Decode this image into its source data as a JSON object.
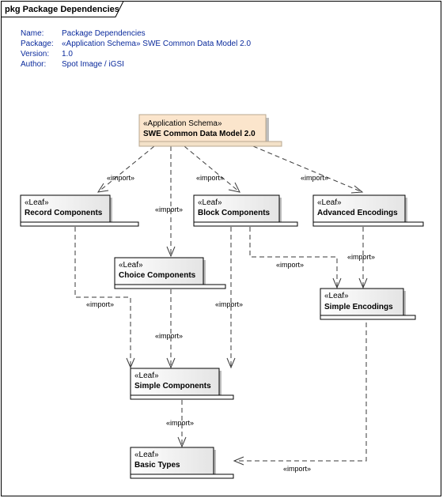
{
  "frame": {
    "title": "pkg Package Dependencies"
  },
  "meta": [
    {
      "key": "Name:",
      "value": "Package Dependencies"
    },
    {
      "key": "Package:",
      "value": "«Application Schema» SWE Common Data Model 2.0"
    },
    {
      "key": "Version:",
      "value": "1.0"
    },
    {
      "key": "Author:",
      "value": "Spot Image / iGSI"
    }
  ],
  "colors": {
    "root_fill": "#fbe5cc",
    "leaf_fill_light": "#ffffff",
    "leaf_fill_dark": "#e6e6e6",
    "meta_text": "#0a2a9c",
    "line": "#3a3a3a"
  },
  "packages": {
    "root": {
      "stereotype": "«Application Schema»",
      "name": "SWE Common Data Model 2.0"
    },
    "record": {
      "stereotype": "«Leaf»",
      "name": "Record Components"
    },
    "block": {
      "stereotype": "«Leaf»",
      "name": "Block Components"
    },
    "advanced": {
      "stereotype": "«Leaf»",
      "name": "Advanced Encodings"
    },
    "choice": {
      "stereotype": "«Leaf»",
      "name": "Choice Components"
    },
    "simple_enc": {
      "stereotype": "«Leaf»",
      "name": "Simple Encodings"
    },
    "simple_comp": {
      "stereotype": "«Leaf»",
      "name": "Simple Components"
    },
    "basic": {
      "stereotype": "«Leaf»",
      "name": "Basic Types"
    }
  },
  "dependency_label": "«import»",
  "dependencies": [
    {
      "from": "SWE Common Data Model 2.0",
      "to": "Record Components",
      "label": "«import»"
    },
    {
      "from": "SWE Common Data Model 2.0",
      "to": "Choice Components",
      "label": "«import»"
    },
    {
      "from": "SWE Common Data Model 2.0",
      "to": "Block Components",
      "label": "«import»"
    },
    {
      "from": "SWE Common Data Model 2.0",
      "to": "Advanced Encodings",
      "label": "«import»"
    },
    {
      "from": "Block Components",
      "to": "Simple Encodings",
      "label": "«import»"
    },
    {
      "from": "Advanced Encodings",
      "to": "Simple Encodings",
      "label": "«import»"
    },
    {
      "from": "Record Components",
      "to": "Simple Components",
      "label": "«import»"
    },
    {
      "from": "Choice Components",
      "to": "Simple Components",
      "label": "«import»"
    },
    {
      "from": "Block Components",
      "to": "Simple Components",
      "label": "«import»"
    },
    {
      "from": "Simple Components",
      "to": "Basic Types",
      "label": "«import»"
    },
    {
      "from": "Simple Encodings",
      "to": "Basic Types",
      "label": "«import»"
    }
  ]
}
